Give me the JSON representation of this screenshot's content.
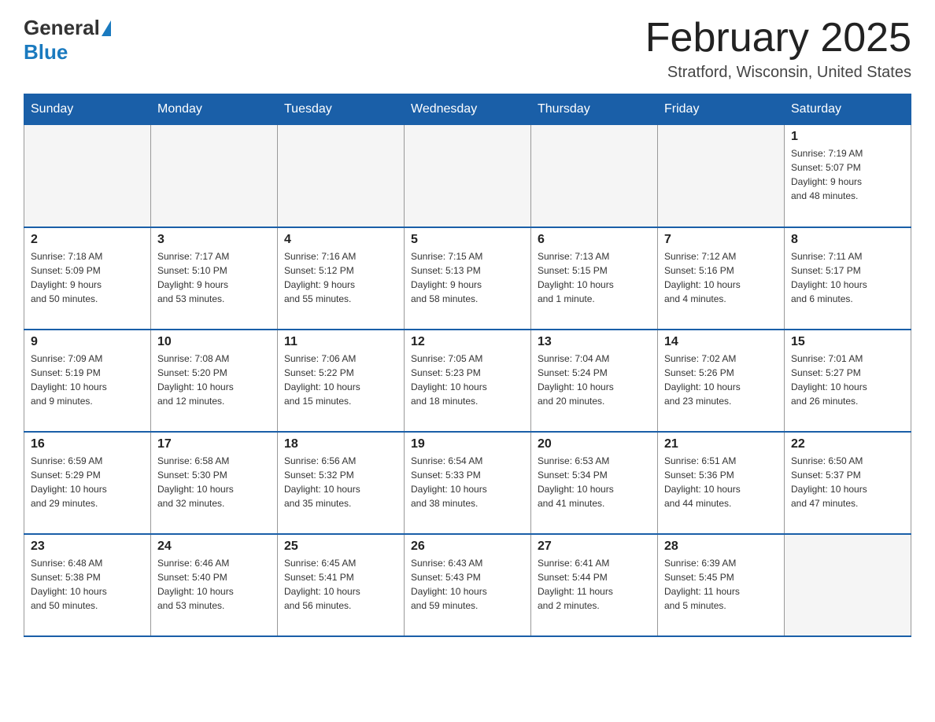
{
  "header": {
    "logo_general": "General",
    "logo_blue": "Blue",
    "title": "February 2025",
    "subtitle": "Stratford, Wisconsin, United States"
  },
  "days_of_week": [
    "Sunday",
    "Monday",
    "Tuesday",
    "Wednesday",
    "Thursday",
    "Friday",
    "Saturday"
  ],
  "weeks": [
    [
      {
        "day": "",
        "info": "",
        "empty": true
      },
      {
        "day": "",
        "info": "",
        "empty": true
      },
      {
        "day": "",
        "info": "",
        "empty": true
      },
      {
        "day": "",
        "info": "",
        "empty": true
      },
      {
        "day": "",
        "info": "",
        "empty": true
      },
      {
        "day": "",
        "info": "",
        "empty": true
      },
      {
        "day": "1",
        "info": "Sunrise: 7:19 AM\nSunset: 5:07 PM\nDaylight: 9 hours\nand 48 minutes.",
        "empty": false
      }
    ],
    [
      {
        "day": "2",
        "info": "Sunrise: 7:18 AM\nSunset: 5:09 PM\nDaylight: 9 hours\nand 50 minutes.",
        "empty": false
      },
      {
        "day": "3",
        "info": "Sunrise: 7:17 AM\nSunset: 5:10 PM\nDaylight: 9 hours\nand 53 minutes.",
        "empty": false
      },
      {
        "day": "4",
        "info": "Sunrise: 7:16 AM\nSunset: 5:12 PM\nDaylight: 9 hours\nand 55 minutes.",
        "empty": false
      },
      {
        "day": "5",
        "info": "Sunrise: 7:15 AM\nSunset: 5:13 PM\nDaylight: 9 hours\nand 58 minutes.",
        "empty": false
      },
      {
        "day": "6",
        "info": "Sunrise: 7:13 AM\nSunset: 5:15 PM\nDaylight: 10 hours\nand 1 minute.",
        "empty": false
      },
      {
        "day": "7",
        "info": "Sunrise: 7:12 AM\nSunset: 5:16 PM\nDaylight: 10 hours\nand 4 minutes.",
        "empty": false
      },
      {
        "day": "8",
        "info": "Sunrise: 7:11 AM\nSunset: 5:17 PM\nDaylight: 10 hours\nand 6 minutes.",
        "empty": false
      }
    ],
    [
      {
        "day": "9",
        "info": "Sunrise: 7:09 AM\nSunset: 5:19 PM\nDaylight: 10 hours\nand 9 minutes.",
        "empty": false
      },
      {
        "day": "10",
        "info": "Sunrise: 7:08 AM\nSunset: 5:20 PM\nDaylight: 10 hours\nand 12 minutes.",
        "empty": false
      },
      {
        "day": "11",
        "info": "Sunrise: 7:06 AM\nSunset: 5:22 PM\nDaylight: 10 hours\nand 15 minutes.",
        "empty": false
      },
      {
        "day": "12",
        "info": "Sunrise: 7:05 AM\nSunset: 5:23 PM\nDaylight: 10 hours\nand 18 minutes.",
        "empty": false
      },
      {
        "day": "13",
        "info": "Sunrise: 7:04 AM\nSunset: 5:24 PM\nDaylight: 10 hours\nand 20 minutes.",
        "empty": false
      },
      {
        "day": "14",
        "info": "Sunrise: 7:02 AM\nSunset: 5:26 PM\nDaylight: 10 hours\nand 23 minutes.",
        "empty": false
      },
      {
        "day": "15",
        "info": "Sunrise: 7:01 AM\nSunset: 5:27 PM\nDaylight: 10 hours\nand 26 minutes.",
        "empty": false
      }
    ],
    [
      {
        "day": "16",
        "info": "Sunrise: 6:59 AM\nSunset: 5:29 PM\nDaylight: 10 hours\nand 29 minutes.",
        "empty": false
      },
      {
        "day": "17",
        "info": "Sunrise: 6:58 AM\nSunset: 5:30 PM\nDaylight: 10 hours\nand 32 minutes.",
        "empty": false
      },
      {
        "day": "18",
        "info": "Sunrise: 6:56 AM\nSunset: 5:32 PM\nDaylight: 10 hours\nand 35 minutes.",
        "empty": false
      },
      {
        "day": "19",
        "info": "Sunrise: 6:54 AM\nSunset: 5:33 PM\nDaylight: 10 hours\nand 38 minutes.",
        "empty": false
      },
      {
        "day": "20",
        "info": "Sunrise: 6:53 AM\nSunset: 5:34 PM\nDaylight: 10 hours\nand 41 minutes.",
        "empty": false
      },
      {
        "day": "21",
        "info": "Sunrise: 6:51 AM\nSunset: 5:36 PM\nDaylight: 10 hours\nand 44 minutes.",
        "empty": false
      },
      {
        "day": "22",
        "info": "Sunrise: 6:50 AM\nSunset: 5:37 PM\nDaylight: 10 hours\nand 47 minutes.",
        "empty": false
      }
    ],
    [
      {
        "day": "23",
        "info": "Sunrise: 6:48 AM\nSunset: 5:38 PM\nDaylight: 10 hours\nand 50 minutes.",
        "empty": false
      },
      {
        "day": "24",
        "info": "Sunrise: 6:46 AM\nSunset: 5:40 PM\nDaylight: 10 hours\nand 53 minutes.",
        "empty": false
      },
      {
        "day": "25",
        "info": "Sunrise: 6:45 AM\nSunset: 5:41 PM\nDaylight: 10 hours\nand 56 minutes.",
        "empty": false
      },
      {
        "day": "26",
        "info": "Sunrise: 6:43 AM\nSunset: 5:43 PM\nDaylight: 10 hours\nand 59 minutes.",
        "empty": false
      },
      {
        "day": "27",
        "info": "Sunrise: 6:41 AM\nSunset: 5:44 PM\nDaylight: 11 hours\nand 2 minutes.",
        "empty": false
      },
      {
        "day": "28",
        "info": "Sunrise: 6:39 AM\nSunset: 5:45 PM\nDaylight: 11 hours\nand 5 minutes.",
        "empty": false
      },
      {
        "day": "",
        "info": "",
        "empty": true
      }
    ]
  ]
}
